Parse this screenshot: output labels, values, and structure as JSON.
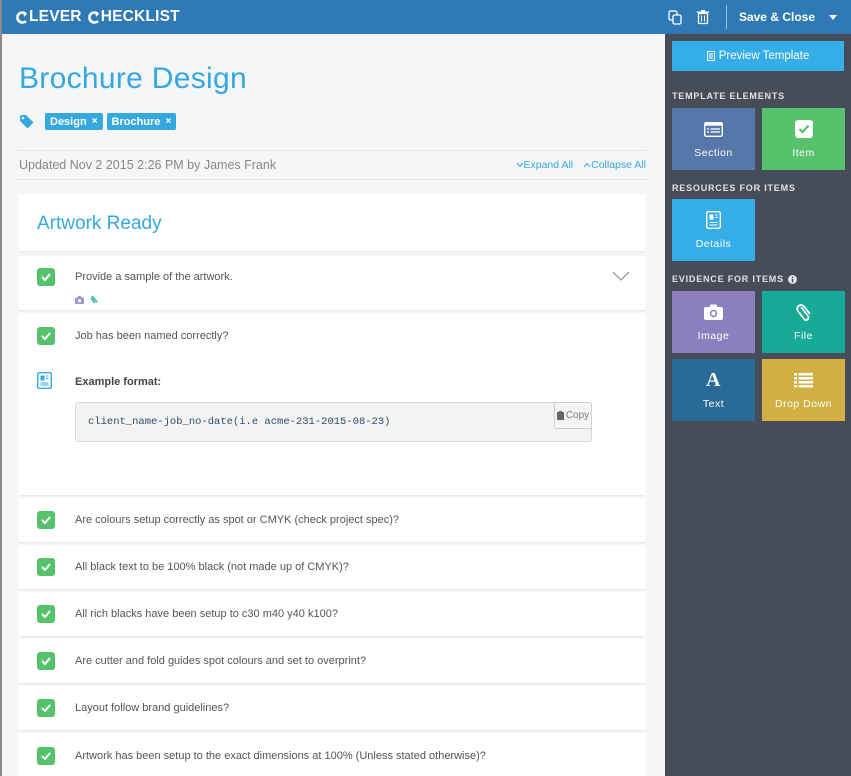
{
  "app": {
    "logo_word1": "LEVER",
    "logo_word2": "HECKLIST",
    "save_close_label": "Save & Close"
  },
  "page": {
    "title": "Brochure Design",
    "tags": [
      "Design",
      "Brochure"
    ],
    "updated": "Updated Nov 2 2015 2:26 PM by James Frank",
    "expand_all": "Expand All",
    "collapse_all": "Collapse All"
  },
  "section": {
    "title": "Artwork Ready",
    "items": [
      {
        "text": "Provide a sample of the artwork.",
        "checked": true
      },
      {
        "text": "Job has been named correctly?",
        "checked": true,
        "details_label": "Example format:",
        "details_code": "client_name-job_no-date(i.e acme-231-2015-08-23)",
        "copy_label": "Copy"
      },
      {
        "text": "Are colours setup correctly as spot or CMYK (check project spec)?",
        "checked": true
      },
      {
        "text": "All black text to be 100% black (not made up of CMYK)?",
        "checked": true
      },
      {
        "text": "All rich blacks have been setup to c30 m40 y40 k100?",
        "checked": true
      },
      {
        "text": "Are cutter and fold guides spot colours and set to overprint?",
        "checked": true
      },
      {
        "text": "Layout follow brand guidelines?",
        "checked": true
      },
      {
        "text": "Artwork has been setup to the exact dimensions at 100% (Unless stated otherwise)?",
        "checked": true
      }
    ]
  },
  "sidebar": {
    "preview_label": "Preview Template",
    "template_elements_heading": "TEMPLATE ELEMENTS",
    "resources_heading": "RESOURCES FOR ITEMS",
    "evidence_heading": "EVIDENCE FOR ITEMS",
    "tiles": {
      "section": "Section",
      "item": "Item",
      "details": "Details",
      "image": "Image",
      "file": "File",
      "text": "Text",
      "dropdown": "Drop Down"
    }
  },
  "colors": {
    "topbar": "#2f79b6",
    "accent": "#35a8e0",
    "check": "#57c16c",
    "sidebar": "#474c59",
    "tile_section": "#5577a9",
    "tile_item": "#57c16c",
    "tile_details": "#35aee8",
    "tile_image": "#8b7fbe",
    "tile_file": "#16aa97",
    "tile_text": "#2a6a97",
    "tile_dropdown": "#d3b044"
  }
}
